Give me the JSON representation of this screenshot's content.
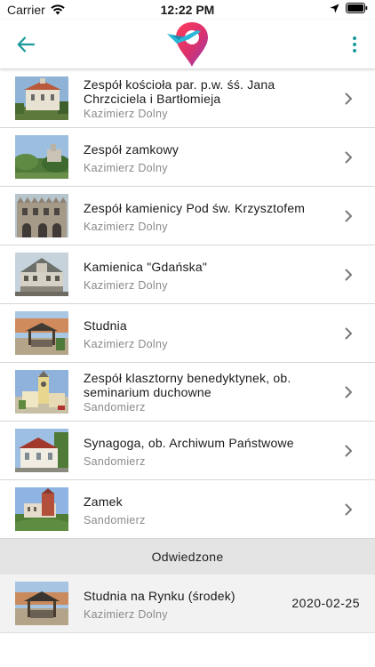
{
  "status_bar": {
    "carrier": "Carrier",
    "time": "12:22 PM"
  },
  "colors": {
    "accent": "#1a9a9a",
    "logo_pink": "#e8305f",
    "logo_purple": "#9b3fb5",
    "logo_cyan": "#2bb8d8"
  },
  "app_bar": {
    "back_icon": "arrow-left-icon",
    "logo_icon": "location-pin-plane-logo",
    "menu_icon": "more-vertical-icon"
  },
  "items": [
    {
      "title": "Zespół kościoła par. p.w. śś. Jana Chrzciciela i Bartłomieja",
      "location": "Kazimierz Dolny"
    },
    {
      "title": "Zespół zamkowy",
      "location": "Kazimierz Dolny"
    },
    {
      "title": "Zespół kamienicy Pod św. Krzysztofem",
      "location": "Kazimierz Dolny"
    },
    {
      "title": "Kamienica \"Gdańska\"",
      "location": "Kazimierz Dolny"
    },
    {
      "title": "Studnia",
      "location": "Kazimierz Dolny"
    },
    {
      "title": "Zespół klasztorny benedyktynek, ob. seminarium duchowne",
      "location": "Sandomierz"
    },
    {
      "title": "Synagoga, ob. Archiwum Państwowe",
      "location": "Sandomierz"
    },
    {
      "title": "Zamek",
      "location": "Sandomierz"
    }
  ],
  "visited_section": {
    "header": "Odwiedzone",
    "items": [
      {
        "title": "Studnia na Rynku (środek)",
        "location": "Kazimierz Dolny",
        "date": "2020-02-25"
      }
    ]
  }
}
